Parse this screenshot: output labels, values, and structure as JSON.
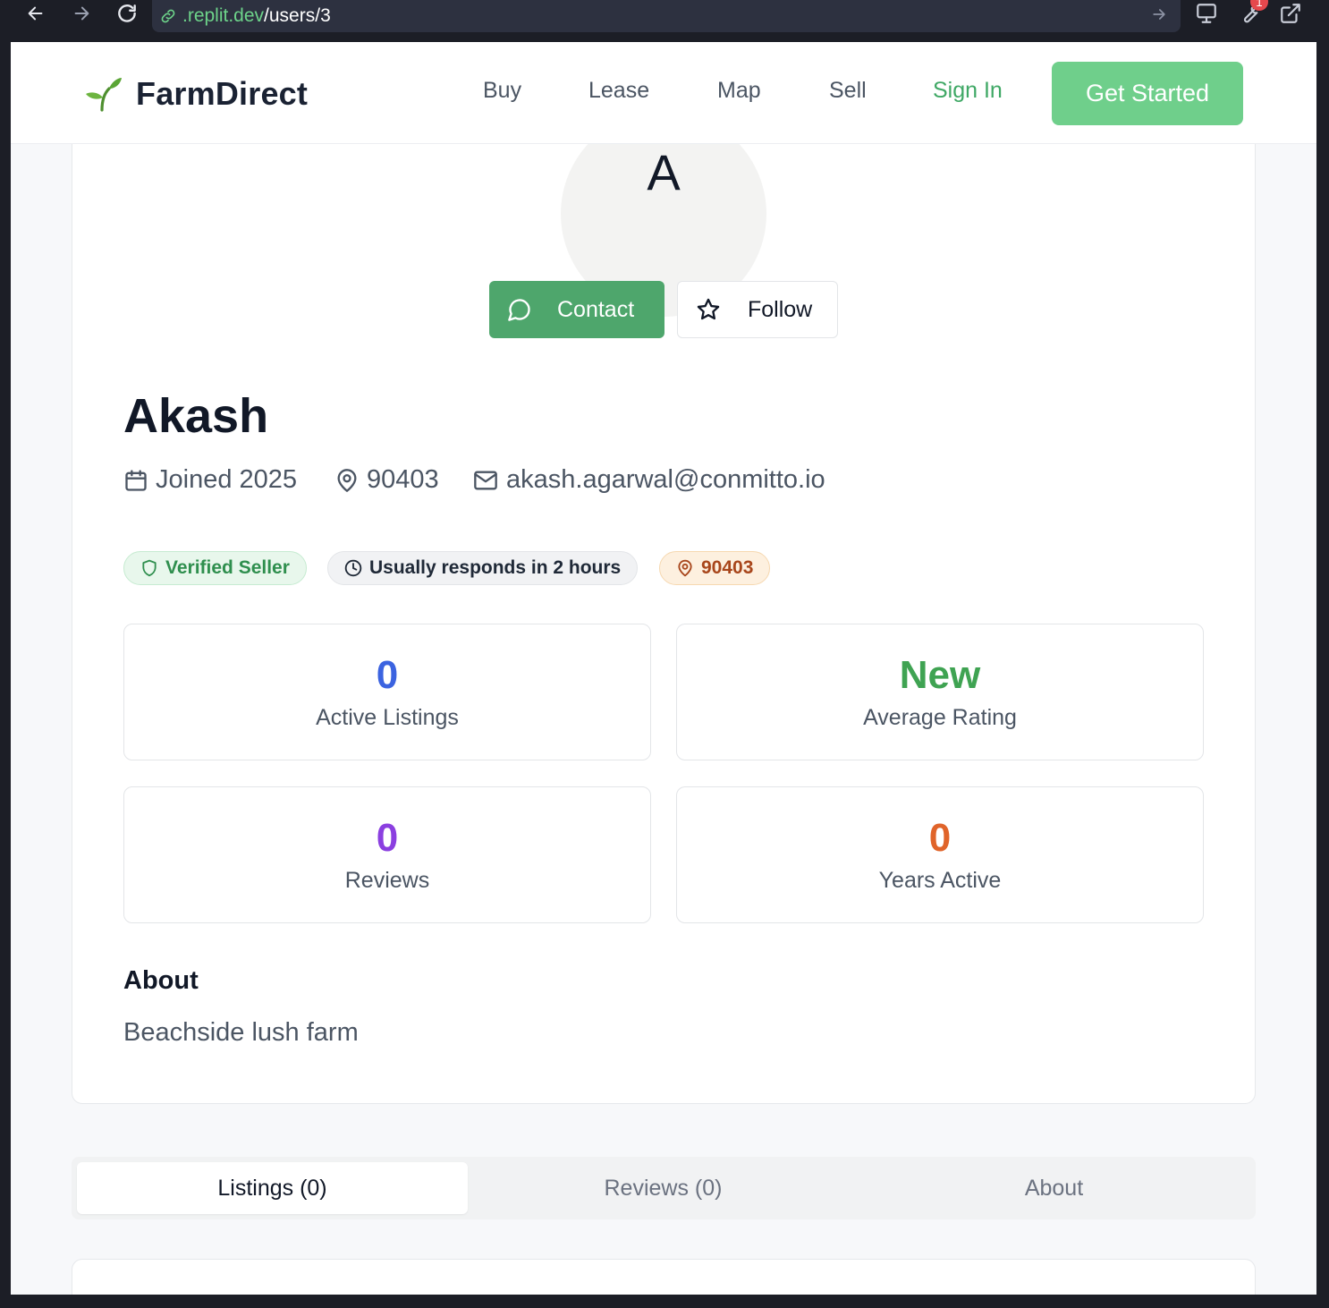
{
  "browser": {
    "url_host": ".replit.dev",
    "url_path": "/users/3",
    "extension_badge": "1"
  },
  "header": {
    "brand": "FarmDirect",
    "nav": [
      "Buy",
      "Lease",
      "Map",
      "Sell"
    ],
    "sign_in": "Sign In",
    "get_started": "Get Started"
  },
  "profile": {
    "avatar_initial": "A",
    "contact_label": "Contact",
    "follow_label": "Follow",
    "name": "Akash",
    "joined": "Joined 2025",
    "zip": "90403",
    "email": "akash.agarwal@conmitto.io",
    "badges": {
      "verified": "Verified Seller",
      "responds": "Usually responds in 2 hours",
      "zip": "90403"
    },
    "stats": [
      {
        "value": "0",
        "label": "Active Listings",
        "color": "#3b63e0"
      },
      {
        "value": "New",
        "label": "Average Rating",
        "color": "#3fa352"
      },
      {
        "value": "0",
        "label": "Reviews",
        "color": "#8b3fe0"
      },
      {
        "value": "0",
        "label": "Years Active",
        "color": "#e0642a"
      }
    ],
    "about_heading": "About",
    "about_text": "Beachside lush farm"
  },
  "tabs": [
    {
      "label": "Listings (0)",
      "active": true
    },
    {
      "label": "Reviews (0)",
      "active": false
    },
    {
      "label": "About",
      "active": false
    }
  ],
  "colors": {
    "brand_green": "#4ea66c",
    "cta_green": "#6fcf8b"
  }
}
